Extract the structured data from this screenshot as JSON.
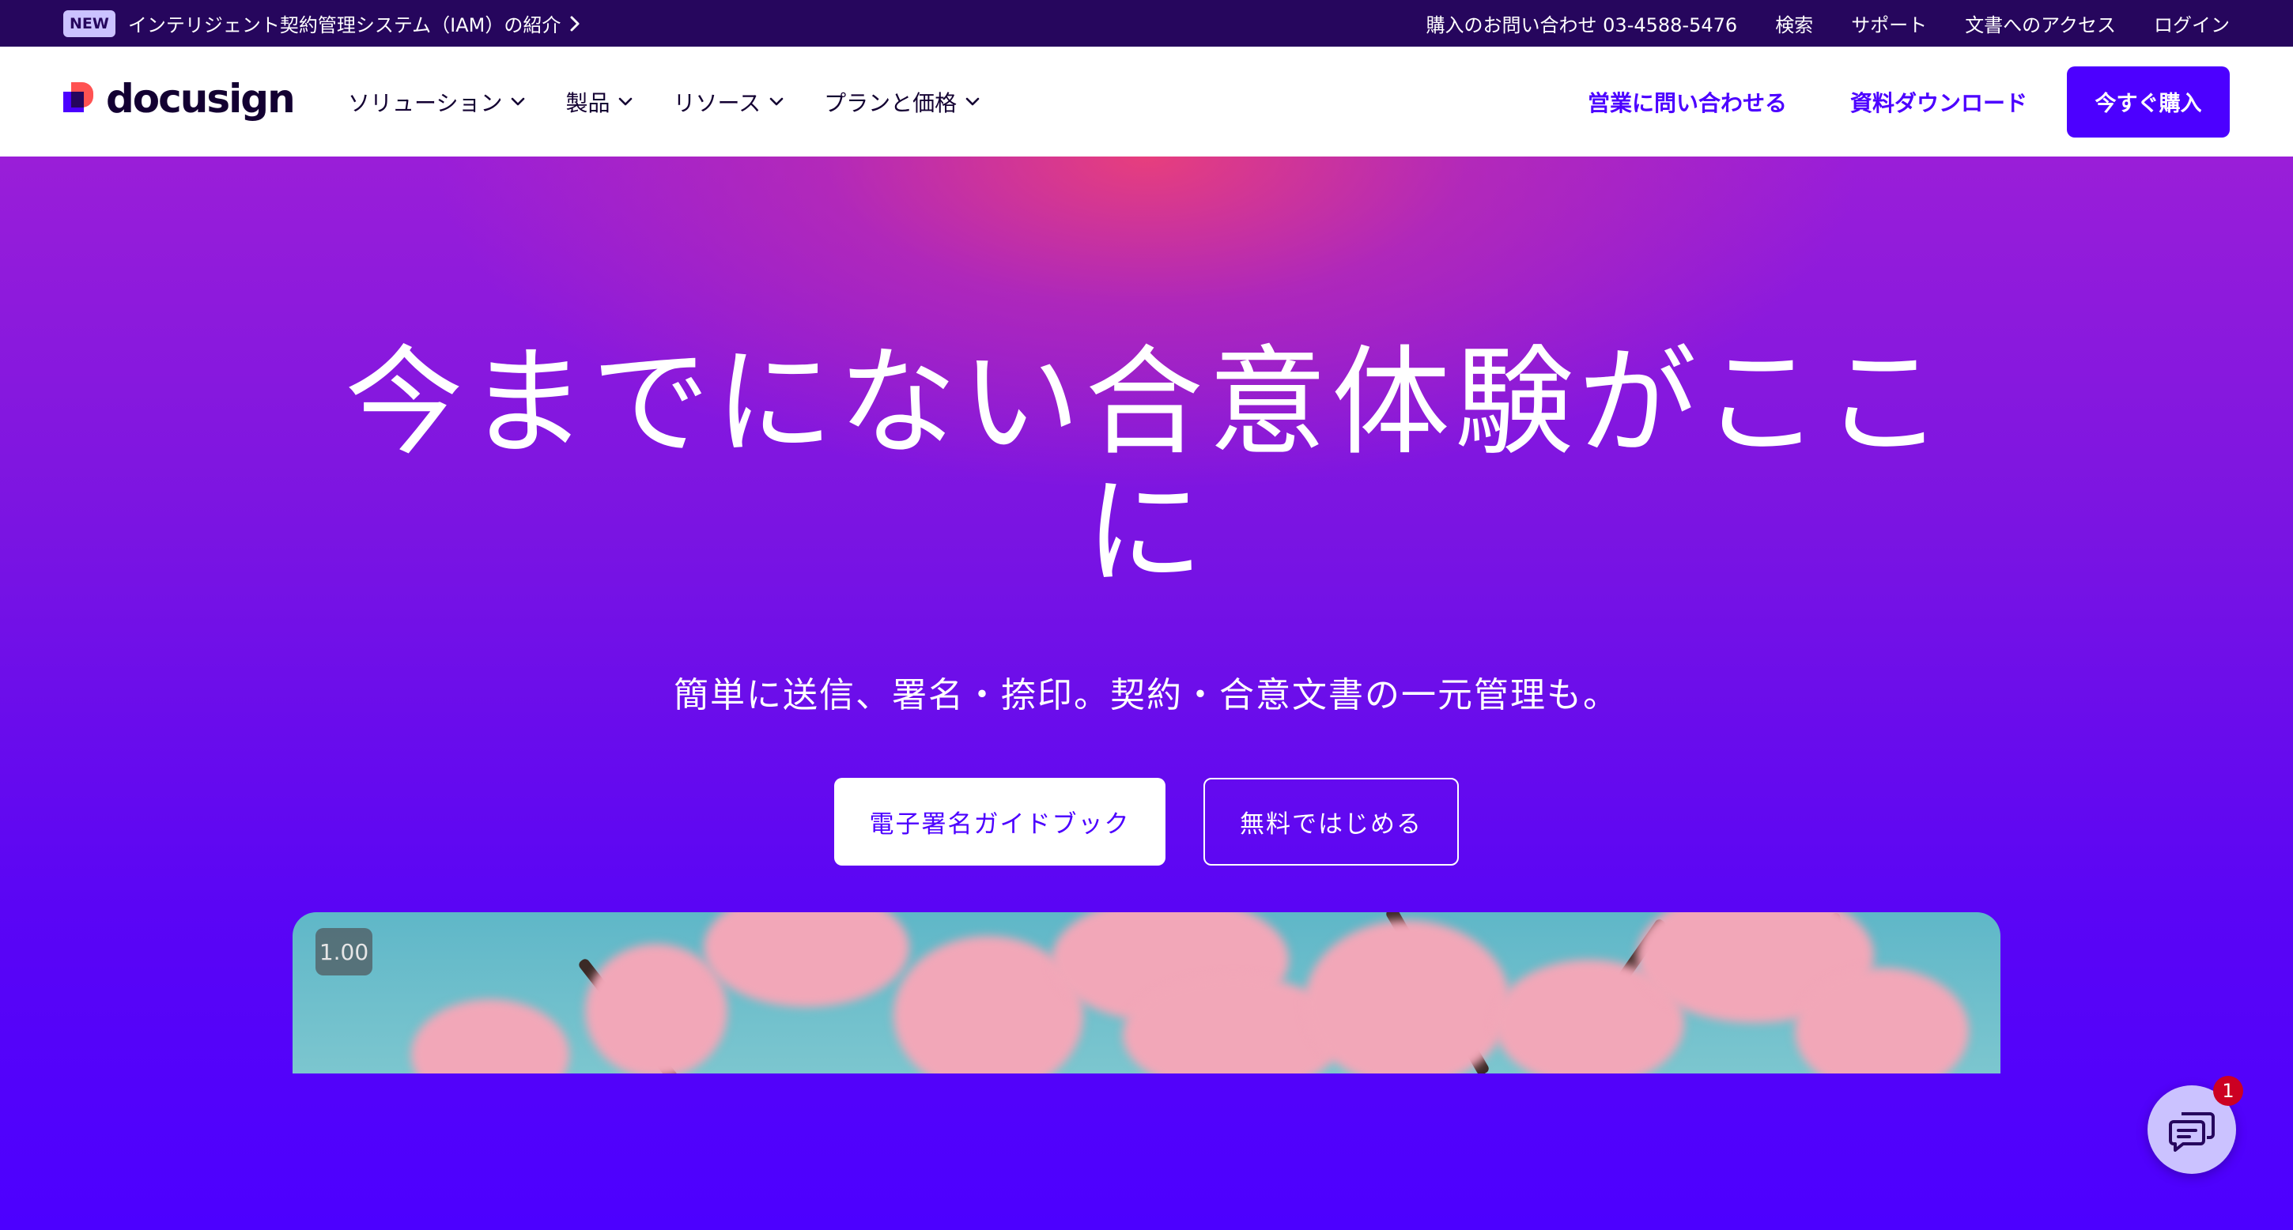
{
  "topbar": {
    "badge": "NEW",
    "promo_text": "インテリジェント契約管理システム（IAM）の紹介",
    "links": {
      "phone": "購入のお問い合わせ 03-4588-5476",
      "search": "検索",
      "support": "サポート",
      "access": "文書へのアクセス",
      "login": "ログイン"
    }
  },
  "nav": {
    "logo_text": "docusign",
    "menu": {
      "solutions": "ソリューション",
      "products": "製品",
      "resources": "リソース",
      "pricing": "プランと価格"
    },
    "contact_sales": "営業に問い合わせる",
    "download": "資料ダウンロード",
    "buy_now": "今すぐ購入"
  },
  "hero": {
    "headline_line1": "今までにない合意体験がここ",
    "headline_line2": "に",
    "subhead": "簡単に送信、署名・捺印。契約・合意文書の一元管理も。",
    "cta_guide": "電子署名ガイドブック",
    "cta_free": "無料ではじめる"
  },
  "media": {
    "speed_label": "1.00"
  },
  "chat": {
    "icon": "chat-icon",
    "badge_count": "1"
  },
  "colors": {
    "brand_purple": "#4c00ff",
    "dark_purple": "#26065d",
    "accent_lavender": "#cbc2ff",
    "coral": "#ff5252"
  }
}
